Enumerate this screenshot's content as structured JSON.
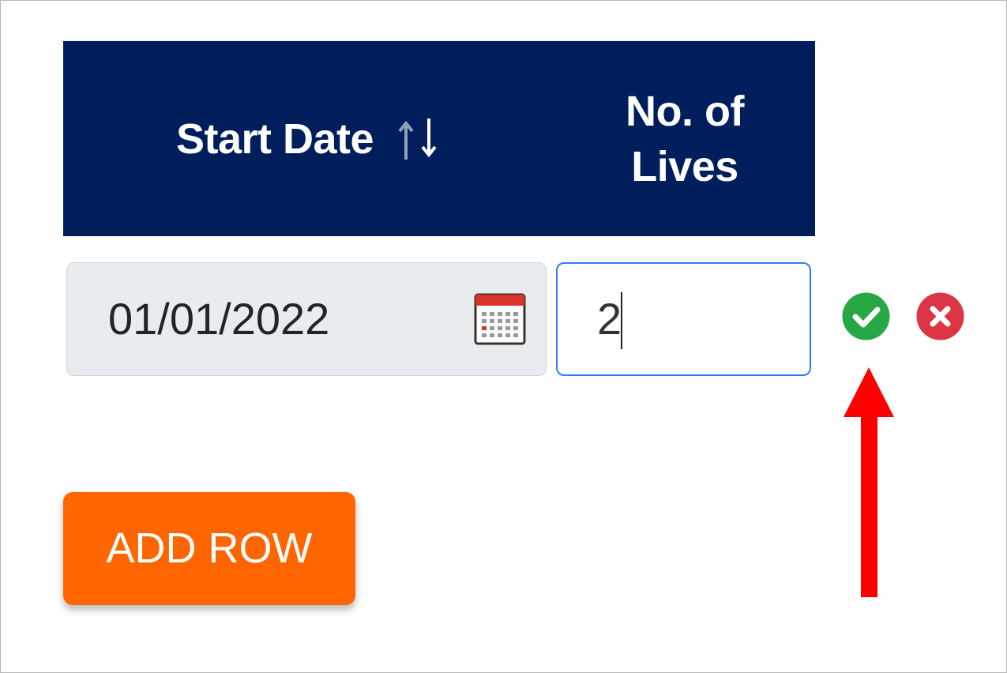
{
  "table": {
    "columns": [
      {
        "label": "Start Date",
        "sortable": true,
        "sort_icon": "sort-arrows-icon"
      },
      {
        "label": "No. of Lives"
      }
    ],
    "header_color": "#001e5c"
  },
  "row": {
    "start_date": "01/01/2022",
    "start_date_icon": "calendar-icon",
    "lives": "2",
    "actions": [
      {
        "icon": "confirm-check-icon",
        "color": "#28a745"
      },
      {
        "icon": "cancel-x-icon",
        "color": "#dc3545"
      }
    ]
  },
  "buttons": {
    "add_row_label": "ADD ROW",
    "add_row_color": "#ff6600"
  },
  "annotation": {
    "icon": "red-arrow-up-icon",
    "color": "#ff0000"
  }
}
